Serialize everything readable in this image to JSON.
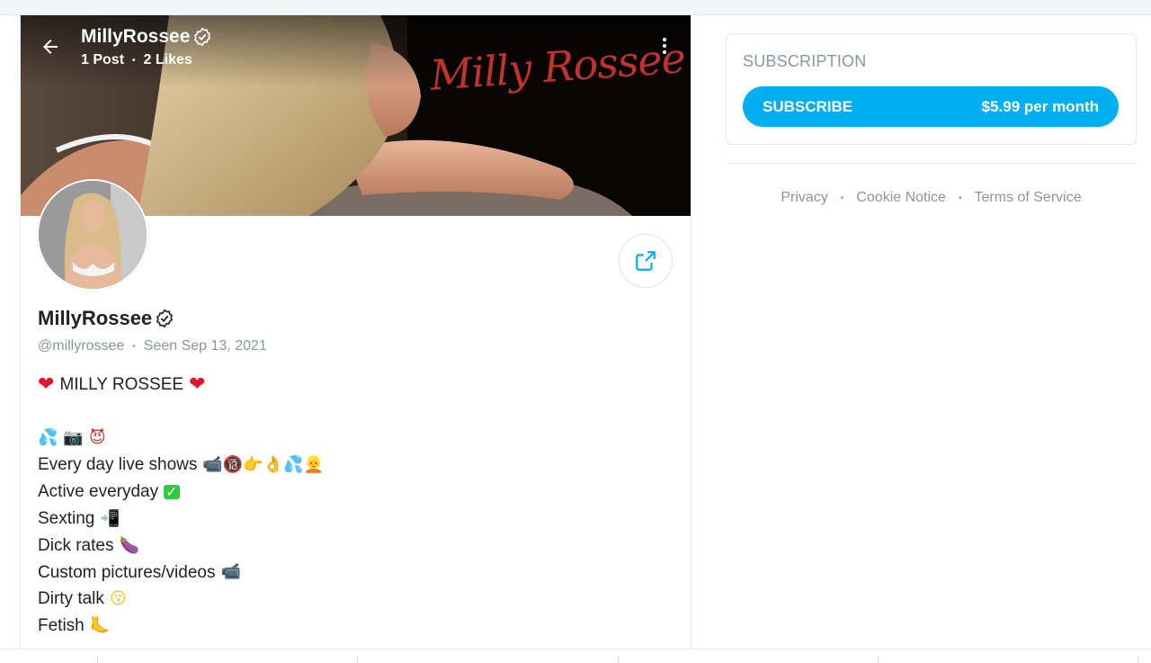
{
  "cover": {
    "name": "MillyRossee",
    "posts": "1 Post",
    "likes": "2 Likes",
    "watermark": "Milly Rossee"
  },
  "profile": {
    "name": "MillyRossee",
    "handle": "@millyrossee",
    "seen": "Seen Sep 13, 2021",
    "bio_title": "MILLY ROSSEE",
    "bio_lines": [
      "Every day live shows",
      "Active everyday",
      "Sexting",
      "Dick rates",
      "Custom pictures/videos",
      "Dirty talk",
      "Fetish"
    ]
  },
  "subscription": {
    "title": "SUBSCRIPTION",
    "button_label": "SUBSCRIBE",
    "price": "$5.99 per month"
  },
  "footer": {
    "privacy": "Privacy",
    "cookie": "Cookie Notice",
    "terms": "Terms of Service"
  },
  "colors": {
    "accent": "#00aff0",
    "muted": "#8a96a3",
    "heart": "#e0142b"
  },
  "icons": [
    "back-arrow-icon",
    "verified-icon",
    "more-vertical-icon",
    "share-icon",
    "heart-icon"
  ]
}
